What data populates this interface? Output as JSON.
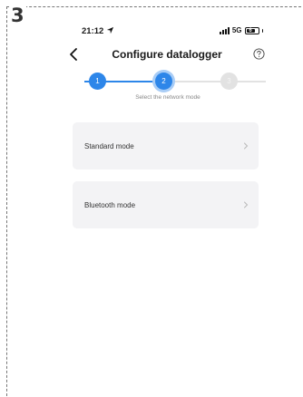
{
  "annotation": {
    "step_number": "3"
  },
  "status_bar": {
    "time": "21:12",
    "network": "5G",
    "battery": "6"
  },
  "nav": {
    "title": "Configure datalogger"
  },
  "stepper": {
    "steps": [
      {
        "label": "1",
        "state": "done"
      },
      {
        "label": "2",
        "state": "active"
      },
      {
        "label": "3",
        "state": "todo"
      }
    ],
    "caption": "Select the network mode"
  },
  "options": [
    {
      "label": "Standard mode",
      "icon": "chevron-right-icon"
    },
    {
      "label": "Bluetooth mode",
      "icon": "chevron-right-icon"
    }
  ],
  "colors": {
    "accent": "#2d86e9",
    "accent_light": "#a9cdf6",
    "inactive": "#e2e2e2",
    "card": "#f3f3f5"
  }
}
